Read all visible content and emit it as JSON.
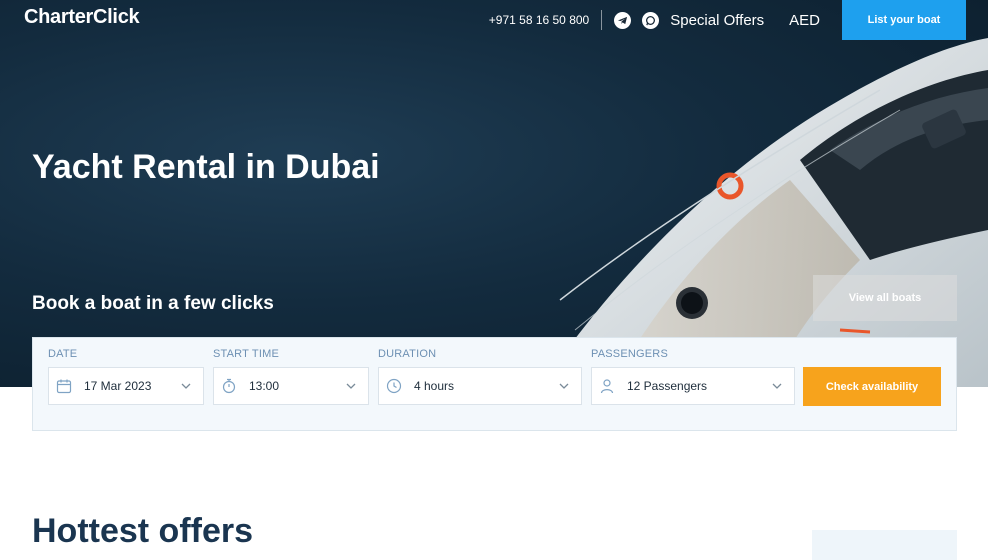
{
  "header": {
    "logo": "CharterClick",
    "phone": "+971 58 16 50 800",
    "social_icons": [
      "telegram-icon",
      "whatsapp-icon"
    ],
    "special_offers": "Special Offers",
    "currency": "AED",
    "list_boat": "List your boat"
  },
  "hero": {
    "title": "Yacht Rental in Dubai",
    "subtitle": "Book a boat in a few clicks",
    "view_all": "View all boats"
  },
  "booking": {
    "date_label": "DATE",
    "date_value": "17 Mar 2023",
    "time_label": "START TIME",
    "time_value": "13:00",
    "duration_label": "DURATION",
    "duration_value": "4 hours",
    "passengers_label": "PASSENGERS",
    "passengers_value": "12 Passengers",
    "check": "Check availability"
  },
  "section": {
    "heading": "Hottest offers"
  },
  "colors": {
    "accent": "#1ea0ee",
    "cta": "#f7a31c",
    "heading": "#1a3550"
  }
}
